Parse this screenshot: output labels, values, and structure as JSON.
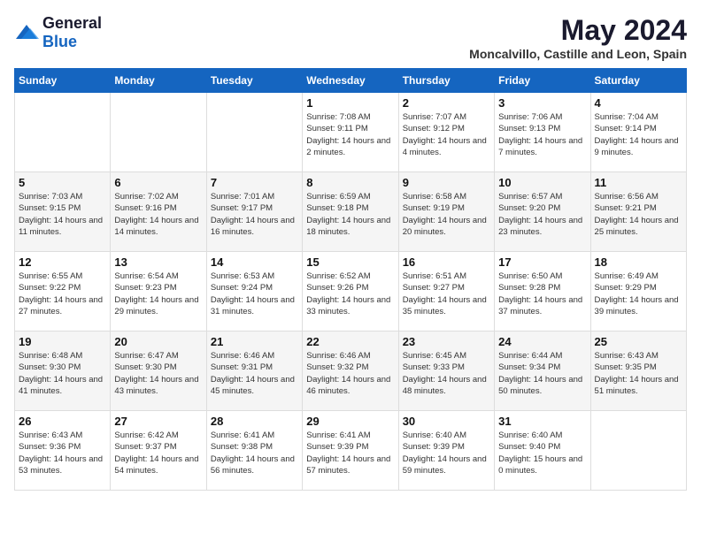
{
  "logo": {
    "general": "General",
    "blue": "Blue"
  },
  "header": {
    "month": "May 2024",
    "location": "Moncalvillo, Castille and Leon, Spain"
  },
  "weekdays": [
    "Sunday",
    "Monday",
    "Tuesday",
    "Wednesday",
    "Thursday",
    "Friday",
    "Saturday"
  ],
  "weeks": [
    [
      {
        "day": "",
        "sunrise": "",
        "sunset": "",
        "daylight": ""
      },
      {
        "day": "",
        "sunrise": "",
        "sunset": "",
        "daylight": ""
      },
      {
        "day": "",
        "sunrise": "",
        "sunset": "",
        "daylight": ""
      },
      {
        "day": "1",
        "sunrise": "Sunrise: 7:08 AM",
        "sunset": "Sunset: 9:11 PM",
        "daylight": "Daylight: 14 hours and 2 minutes."
      },
      {
        "day": "2",
        "sunrise": "Sunrise: 7:07 AM",
        "sunset": "Sunset: 9:12 PM",
        "daylight": "Daylight: 14 hours and 4 minutes."
      },
      {
        "day": "3",
        "sunrise": "Sunrise: 7:06 AM",
        "sunset": "Sunset: 9:13 PM",
        "daylight": "Daylight: 14 hours and 7 minutes."
      },
      {
        "day": "4",
        "sunrise": "Sunrise: 7:04 AM",
        "sunset": "Sunset: 9:14 PM",
        "daylight": "Daylight: 14 hours and 9 minutes."
      }
    ],
    [
      {
        "day": "5",
        "sunrise": "Sunrise: 7:03 AM",
        "sunset": "Sunset: 9:15 PM",
        "daylight": "Daylight: 14 hours and 11 minutes."
      },
      {
        "day": "6",
        "sunrise": "Sunrise: 7:02 AM",
        "sunset": "Sunset: 9:16 PM",
        "daylight": "Daylight: 14 hours and 14 minutes."
      },
      {
        "day": "7",
        "sunrise": "Sunrise: 7:01 AM",
        "sunset": "Sunset: 9:17 PM",
        "daylight": "Daylight: 14 hours and 16 minutes."
      },
      {
        "day": "8",
        "sunrise": "Sunrise: 6:59 AM",
        "sunset": "Sunset: 9:18 PM",
        "daylight": "Daylight: 14 hours and 18 minutes."
      },
      {
        "day": "9",
        "sunrise": "Sunrise: 6:58 AM",
        "sunset": "Sunset: 9:19 PM",
        "daylight": "Daylight: 14 hours and 20 minutes."
      },
      {
        "day": "10",
        "sunrise": "Sunrise: 6:57 AM",
        "sunset": "Sunset: 9:20 PM",
        "daylight": "Daylight: 14 hours and 23 minutes."
      },
      {
        "day": "11",
        "sunrise": "Sunrise: 6:56 AM",
        "sunset": "Sunset: 9:21 PM",
        "daylight": "Daylight: 14 hours and 25 minutes."
      }
    ],
    [
      {
        "day": "12",
        "sunrise": "Sunrise: 6:55 AM",
        "sunset": "Sunset: 9:22 PM",
        "daylight": "Daylight: 14 hours and 27 minutes."
      },
      {
        "day": "13",
        "sunrise": "Sunrise: 6:54 AM",
        "sunset": "Sunset: 9:23 PM",
        "daylight": "Daylight: 14 hours and 29 minutes."
      },
      {
        "day": "14",
        "sunrise": "Sunrise: 6:53 AM",
        "sunset": "Sunset: 9:24 PM",
        "daylight": "Daylight: 14 hours and 31 minutes."
      },
      {
        "day": "15",
        "sunrise": "Sunrise: 6:52 AM",
        "sunset": "Sunset: 9:26 PM",
        "daylight": "Daylight: 14 hours and 33 minutes."
      },
      {
        "day": "16",
        "sunrise": "Sunrise: 6:51 AM",
        "sunset": "Sunset: 9:27 PM",
        "daylight": "Daylight: 14 hours and 35 minutes."
      },
      {
        "day": "17",
        "sunrise": "Sunrise: 6:50 AM",
        "sunset": "Sunset: 9:28 PM",
        "daylight": "Daylight: 14 hours and 37 minutes."
      },
      {
        "day": "18",
        "sunrise": "Sunrise: 6:49 AM",
        "sunset": "Sunset: 9:29 PM",
        "daylight": "Daylight: 14 hours and 39 minutes."
      }
    ],
    [
      {
        "day": "19",
        "sunrise": "Sunrise: 6:48 AM",
        "sunset": "Sunset: 9:30 PM",
        "daylight": "Daylight: 14 hours and 41 minutes."
      },
      {
        "day": "20",
        "sunrise": "Sunrise: 6:47 AM",
        "sunset": "Sunset: 9:30 PM",
        "daylight": "Daylight: 14 hours and 43 minutes."
      },
      {
        "day": "21",
        "sunrise": "Sunrise: 6:46 AM",
        "sunset": "Sunset: 9:31 PM",
        "daylight": "Daylight: 14 hours and 45 minutes."
      },
      {
        "day": "22",
        "sunrise": "Sunrise: 6:46 AM",
        "sunset": "Sunset: 9:32 PM",
        "daylight": "Daylight: 14 hours and 46 minutes."
      },
      {
        "day": "23",
        "sunrise": "Sunrise: 6:45 AM",
        "sunset": "Sunset: 9:33 PM",
        "daylight": "Daylight: 14 hours and 48 minutes."
      },
      {
        "day": "24",
        "sunrise": "Sunrise: 6:44 AM",
        "sunset": "Sunset: 9:34 PM",
        "daylight": "Daylight: 14 hours and 50 minutes."
      },
      {
        "day": "25",
        "sunrise": "Sunrise: 6:43 AM",
        "sunset": "Sunset: 9:35 PM",
        "daylight": "Daylight: 14 hours and 51 minutes."
      }
    ],
    [
      {
        "day": "26",
        "sunrise": "Sunrise: 6:43 AM",
        "sunset": "Sunset: 9:36 PM",
        "daylight": "Daylight: 14 hours and 53 minutes."
      },
      {
        "day": "27",
        "sunrise": "Sunrise: 6:42 AM",
        "sunset": "Sunset: 9:37 PM",
        "daylight": "Daylight: 14 hours and 54 minutes."
      },
      {
        "day": "28",
        "sunrise": "Sunrise: 6:41 AM",
        "sunset": "Sunset: 9:38 PM",
        "daylight": "Daylight: 14 hours and 56 minutes."
      },
      {
        "day": "29",
        "sunrise": "Sunrise: 6:41 AM",
        "sunset": "Sunset: 9:39 PM",
        "daylight": "Daylight: 14 hours and 57 minutes."
      },
      {
        "day": "30",
        "sunrise": "Sunrise: 6:40 AM",
        "sunset": "Sunset: 9:39 PM",
        "daylight": "Daylight: 14 hours and 59 minutes."
      },
      {
        "day": "31",
        "sunrise": "Sunrise: 6:40 AM",
        "sunset": "Sunset: 9:40 PM",
        "daylight": "Daylight: 15 hours and 0 minutes."
      },
      {
        "day": "",
        "sunrise": "",
        "sunset": "",
        "daylight": ""
      }
    ]
  ]
}
